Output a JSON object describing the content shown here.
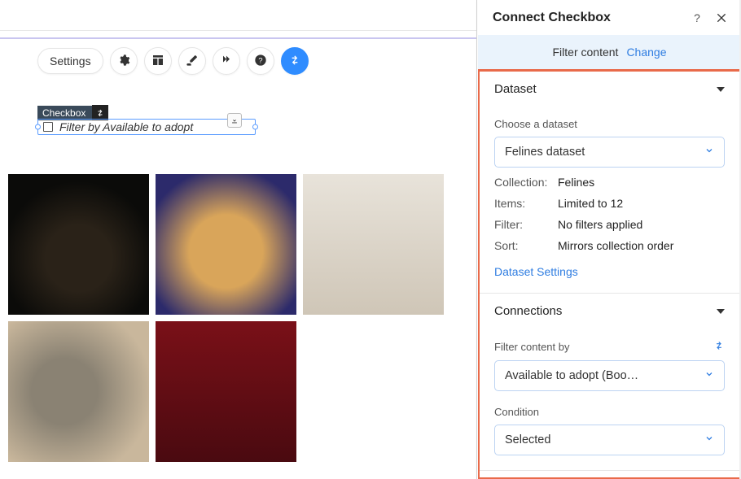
{
  "toolbar": {
    "settings_label": "Settings"
  },
  "element": {
    "tag_label": "Checkbox",
    "checkbox_text": "Filter by Available to adopt"
  },
  "panel": {
    "title": "Connect Checkbox",
    "filter_strip": {
      "label": "Filter content",
      "change": "Change"
    },
    "dataset": {
      "heading": "Dataset",
      "choose_label": "Choose a dataset",
      "dataset_value": "Felines dataset",
      "collection_k": "Collection:",
      "collection_v": "Felines",
      "items_k": "Items:",
      "items_v": "Limited to 12",
      "filter_k": "Filter:",
      "filter_v": "No filters applied",
      "sort_k": "Sort:",
      "sort_v": "Mirrors collection order",
      "settings_link": "Dataset Settings"
    },
    "connections": {
      "heading": "Connections",
      "filter_by_label": "Filter content by",
      "filter_by_value": "Available to adopt (Boo…",
      "condition_label": "Condition",
      "condition_value": "Selected"
    }
  }
}
